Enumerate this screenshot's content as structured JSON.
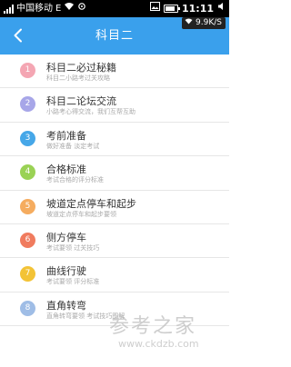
{
  "status_bar": {
    "carrier": "中国移动",
    "network": "E",
    "time": "11:11",
    "speed": "9.9K/S"
  },
  "header": {
    "title": "科目二"
  },
  "items": [
    {
      "number": "1",
      "title": "科目二必过秘籍",
      "subtitle": "科目二小路考过关攻略",
      "color": "#f4a6b3"
    },
    {
      "number": "2",
      "title": "科目二论坛交流",
      "subtitle": "小路考心得交流，我们互帮互助",
      "color": "#a7a6e8"
    },
    {
      "number": "3",
      "title": "考前准备",
      "subtitle": "做好准备 淡定考试",
      "color": "#46a7e8"
    },
    {
      "number": "4",
      "title": "合格标准",
      "subtitle": "考试合格的评分标准",
      "color": "#9ad255"
    },
    {
      "number": "5",
      "title": "坡道定点停车和起步",
      "subtitle": "坡道定点停车和起步要领",
      "color": "#f5ac5f"
    },
    {
      "number": "6",
      "title": "侧方停车",
      "subtitle": "考试要领 过关技巧",
      "color": "#f07b5e"
    },
    {
      "number": "7",
      "title": "曲线行驶",
      "subtitle": "考试要领 评分标准",
      "color": "#f3c336"
    },
    {
      "number": "8",
      "title": "直角转弯",
      "subtitle": "直角转弯要领 考试技巧图解",
      "color": "#9fbde6"
    }
  ],
  "watermark": {
    "text": "参考之家",
    "url": "www.ckdzb.com"
  }
}
